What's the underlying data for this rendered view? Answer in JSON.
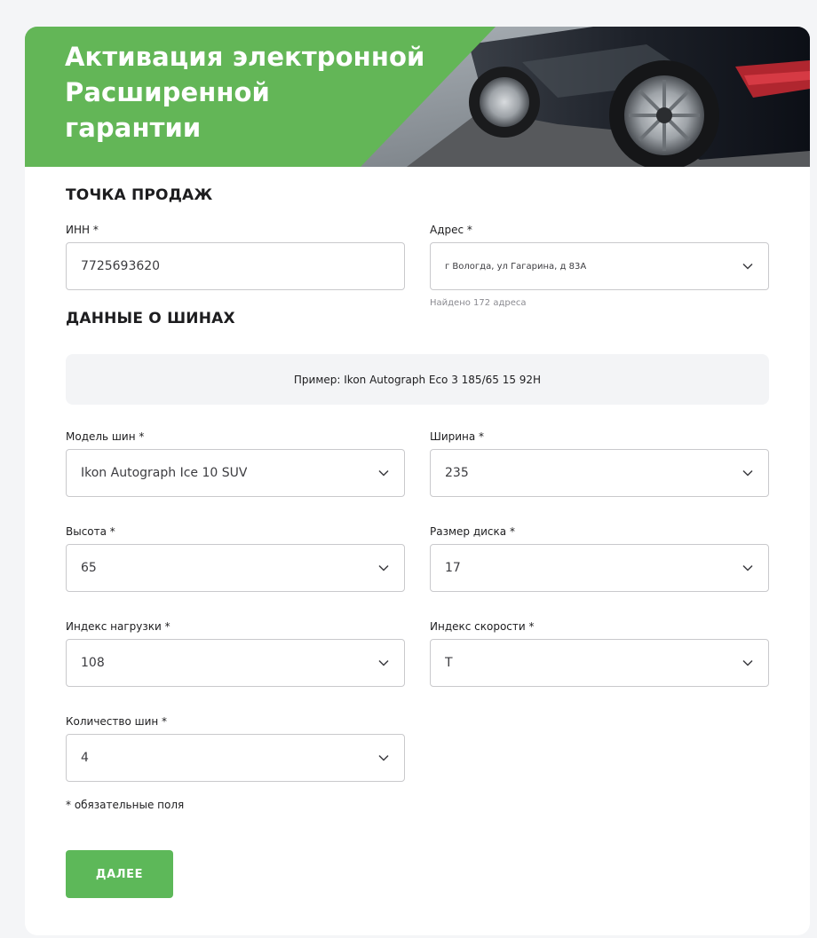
{
  "hero": {
    "title": "Активация электронной\nРасширенной\nгарантии",
    "accent_color": "#63b657"
  },
  "sale_point": {
    "section_title": "ТОЧКА ПРОДАЖ",
    "inn": {
      "label": "ИНН *",
      "value": "7725693620"
    },
    "address": {
      "label": "Адрес *",
      "value": "г Вологда, ул Гагарина, д 83А",
      "hint": "Найдено 172 адреса",
      "icon": "chevron-down-icon"
    }
  },
  "tires": {
    "section_title": "ДАННЫЕ О ШИНАХ",
    "example": "Пример: Ikon Autograph Eco 3 185/65 15 92H",
    "model": {
      "label": "Модель шин *",
      "value": "Ikon Autograph Ice 10 SUV"
    },
    "width": {
      "label": "Ширина *",
      "value": "235"
    },
    "height": {
      "label": "Высота *",
      "value": "65"
    },
    "rim": {
      "label": "Размер диска *",
      "value": "17"
    },
    "load_index": {
      "label": "Индекс нагрузки *",
      "value": "108"
    },
    "speed_index": {
      "label": "Индекс скорости *",
      "value": "T"
    },
    "quantity": {
      "label": "Количество шин *",
      "value": "4"
    }
  },
  "form": {
    "required_note": "* обязательные поля",
    "next_label": "ДАЛЕЕ",
    "button_color": "#5db859"
  }
}
